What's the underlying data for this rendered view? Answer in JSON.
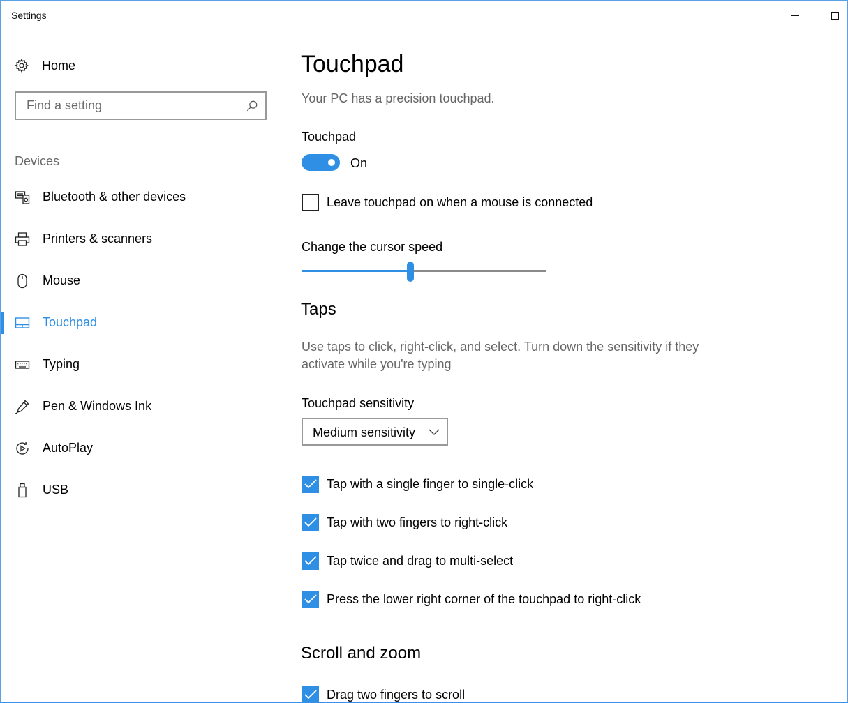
{
  "window": {
    "title": "Settings"
  },
  "sidebar": {
    "home_label": "Home",
    "search_placeholder": "Find a setting",
    "group_label": "Devices",
    "items": [
      {
        "label": "Bluetooth & other devices",
        "icon": "bluetooth-devices-icon"
      },
      {
        "label": "Printers & scanners",
        "icon": "printer-icon"
      },
      {
        "label": "Mouse",
        "icon": "mouse-icon"
      },
      {
        "label": "Touchpad",
        "icon": "touchpad-icon",
        "active": true
      },
      {
        "label": "Typing",
        "icon": "keyboard-icon"
      },
      {
        "label": "Pen & Windows Ink",
        "icon": "pen-icon"
      },
      {
        "label": "AutoPlay",
        "icon": "autoplay-icon"
      },
      {
        "label": "USB",
        "icon": "usb-icon"
      }
    ]
  },
  "main": {
    "title": "Touchpad",
    "subtitle": "Your PC has a precision touchpad.",
    "touchpad_label": "Touchpad",
    "toggle_state": "On",
    "toggle_on": true,
    "leave_on_label": "Leave touchpad on when a mouse is connected",
    "leave_on_checked": false,
    "cursor_speed_label": "Change the cursor speed",
    "cursor_speed_fraction": 0.445,
    "taps": {
      "title": "Taps",
      "description": "Use taps to click, right-click, and select. Turn down the sensitivity if they activate while you're typing",
      "sensitivity_label": "Touchpad sensitivity",
      "sensitivity_value": "Medium sensitivity",
      "options": [
        {
          "label": "Tap with a single finger to single-click",
          "checked": true
        },
        {
          "label": "Tap with two fingers to right-click",
          "checked": true
        },
        {
          "label": "Tap twice and drag to multi-select",
          "checked": true
        },
        {
          "label": "Press the lower right corner of the touchpad to right-click",
          "checked": true
        }
      ]
    },
    "scroll_zoom": {
      "title": "Scroll and zoom",
      "options": [
        {
          "label": "Drag two fingers to scroll",
          "checked": true
        }
      ]
    }
  },
  "colors": {
    "accent": "#2f8fe4",
    "secondary_text": "#666666",
    "window_border": "#5aa0e6"
  }
}
